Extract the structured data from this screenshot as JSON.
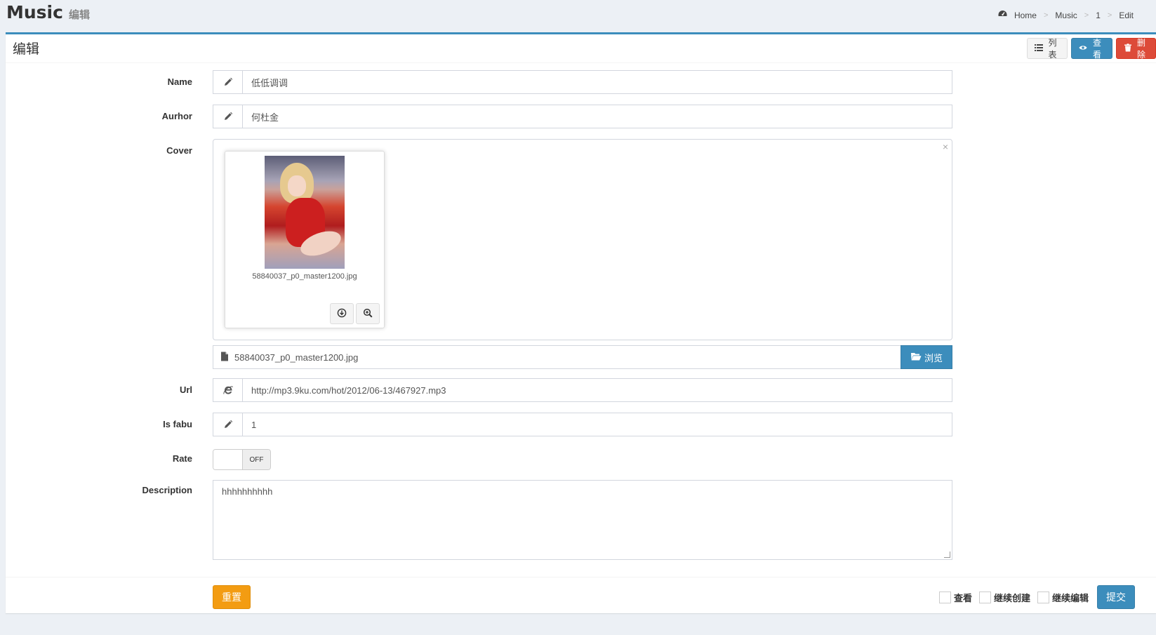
{
  "header": {
    "title": "Music",
    "subtitle": "编辑",
    "breadcrumb": [
      "Home",
      "Music",
      "1",
      "Edit"
    ]
  },
  "box": {
    "title": "编辑",
    "tools": {
      "list_label": "列表",
      "view_label": "查看",
      "delete_label": "删除"
    }
  },
  "form": {
    "name": {
      "label": "Name",
      "value": "低低调调"
    },
    "author": {
      "label": "Aurhor",
      "value": "何杜金"
    },
    "cover": {
      "label": "Cover",
      "filename": "58840037_p0_master1200.jpg",
      "caption": "58840037_p0_master1200.jpg",
      "browse_label": "浏览"
    },
    "url": {
      "label": "Url",
      "value": "http://mp3.9ku.com/hot/2012/06-13/467927.mp3"
    },
    "is_fabu": {
      "label": "Is fabu",
      "value": "1"
    },
    "rate": {
      "label": "Rate",
      "switch_label": "OFF",
      "on": false
    },
    "description": {
      "label": "Description",
      "value": "hhhhhhhhhh"
    }
  },
  "footer": {
    "reset_label": "重置",
    "checks": [
      "查看",
      "继续创建",
      "继续编辑"
    ],
    "submit_label": "提交"
  },
  "colors": {
    "primary": "#3c8dbc",
    "danger": "#dd4b39",
    "warning": "#f39c12",
    "background": "#ecf0f5"
  }
}
